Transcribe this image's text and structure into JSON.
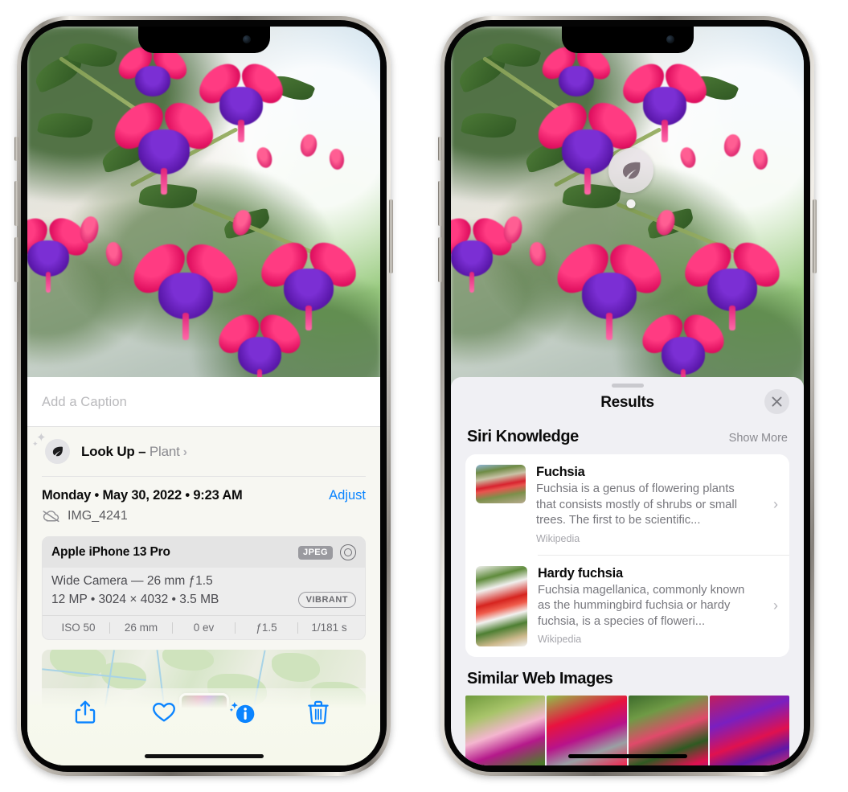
{
  "left_phone": {
    "name": "iPhone photo info screen",
    "caption_placeholder": "Add a Caption",
    "lookup": {
      "label": "Look Up –",
      "subject": "Plant",
      "icon": "leaf-icon",
      "chevron": "›"
    },
    "meta": {
      "date": "Monday • May 30, 2022 • 9:23 AM",
      "adjust_label": "Adjust",
      "filename": "IMG_4241",
      "cloud_icon": "cloud-slash-icon"
    },
    "exif": {
      "model": "Apple iPhone 13 Pro",
      "format_badge": "JPEG",
      "lens_icon": "lens-icon",
      "lens_line": "Wide Camera — 26 mm ƒ1.5",
      "size_line": "12 MP • 3024 × 4032 • 3.5 MB",
      "style_badge": "VIBRANT",
      "stats": [
        "ISO 50",
        "26 mm",
        "0 ev",
        "ƒ1.5",
        "1/181 s"
      ]
    },
    "toolbar": [
      {
        "name": "share-icon",
        "label": "Share"
      },
      {
        "name": "heart-icon",
        "label": "Favorite"
      },
      {
        "name": "info-sparkle-icon",
        "label": "Info"
      },
      {
        "name": "trash-icon",
        "label": "Delete"
      }
    ]
  },
  "right_phone": {
    "name": "Visual Look Up results screen",
    "badge_icon": "leaf-icon",
    "header": {
      "title": "Results",
      "close_icon": "close-icon"
    },
    "siri_knowledge": {
      "title": "Siri Knowledge",
      "show_more": "Show More",
      "items": [
        {
          "title": "Fuchsia",
          "description": "Fuchsia is a genus of flowering plants that consists mostly of shrubs or small trees. The first to be scientific...",
          "source": "Wikipedia",
          "chevron": "›"
        },
        {
          "title": "Hardy fuchsia",
          "description": "Fuchsia magellanica, commonly known as the hummingbird fuchsia or hardy fuchsia, is a species of floweri...",
          "source": "Wikipedia",
          "chevron": "›"
        }
      ]
    },
    "similar_web_images": {
      "title": "Similar Web Images",
      "count": 4
    }
  },
  "colors": {
    "accent_blue": "#0a84ff",
    "sheet_bg": "#F7F7F2",
    "results_bg": "#F0F0F4",
    "card_bg": "#ffffff",
    "muted_text": "#8a8a90"
  }
}
